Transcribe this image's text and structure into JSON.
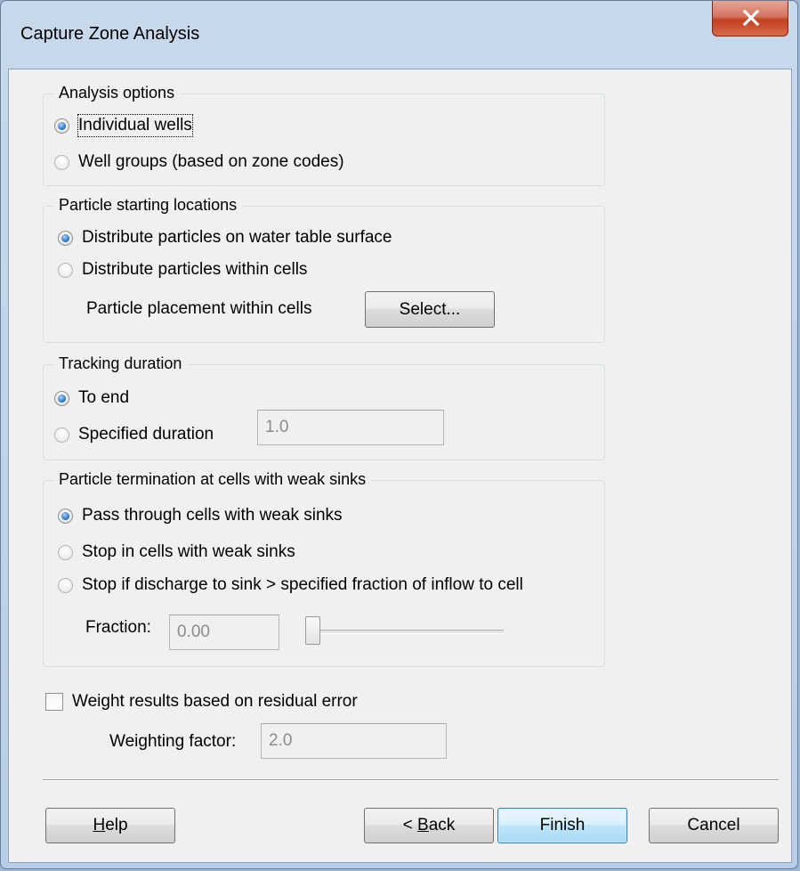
{
  "window": {
    "title": "Capture Zone Analysis"
  },
  "analysis_options": {
    "legend": "Analysis options",
    "options": [
      {
        "label": "Individual wells",
        "checked": true
      },
      {
        "label": "Well groups (based on zone codes)",
        "checked": false
      }
    ]
  },
  "particle_start": {
    "legend": "Particle starting locations",
    "options": [
      {
        "label": "Distribute particles on water table surface",
        "checked": true
      },
      {
        "label": "Distribute particles within cells",
        "checked": false
      }
    ],
    "placement_label": "Particle placement within cells",
    "select_button": "Select..."
  },
  "tracking_duration": {
    "legend": "Tracking duration",
    "options": [
      {
        "label": "To end",
        "checked": true
      },
      {
        "label": "Specified duration",
        "checked": false
      }
    ],
    "duration_value": "1.0"
  },
  "termination": {
    "legend": "Particle termination at cells with weak sinks",
    "options": [
      {
        "label": "Pass through cells with weak sinks",
        "checked": true
      },
      {
        "label": "Stop in cells with weak sinks",
        "checked": false
      },
      {
        "label": "Stop if discharge to sink > specified fraction of inflow to cell",
        "checked": false
      }
    ],
    "fraction_label": "Fraction:",
    "fraction_value": "0.00",
    "fraction_slider_level": 0.0
  },
  "weight": {
    "checkbox_label": "Weight results based on residual error",
    "checked": false,
    "factor_label": "Weighting factor:",
    "factor_value": "2.0"
  },
  "buttons": {
    "help_mnemonic": "H",
    "help_rest": "elp",
    "back_prefix": "< ",
    "back_mnemonic": "B",
    "back_rest": "ack",
    "finish": "Finish",
    "cancel": "Cancel"
  }
}
